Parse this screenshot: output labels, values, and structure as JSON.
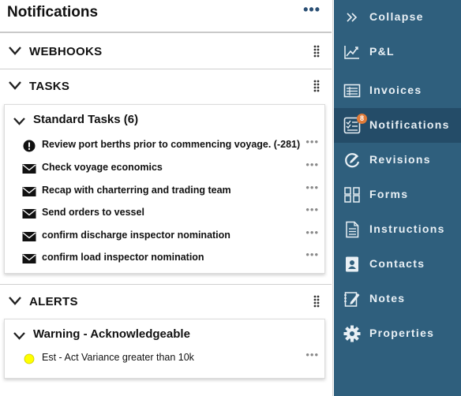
{
  "panel": {
    "title": "Notifications",
    "more_label": "•••"
  },
  "sections": {
    "webhooks": {
      "label": "WEBHOOKS"
    },
    "tasks": {
      "label": "TASKS"
    },
    "alerts": {
      "label": "ALERTS"
    }
  },
  "tasks_group": {
    "title": "Standard Tasks (6)",
    "items": [
      {
        "text": "Review port berths prior to commencing voyage. (-281)",
        "icon": "alert-icon"
      },
      {
        "text": "Check voyage economics",
        "icon": "envelope-icon"
      },
      {
        "text": "Recap with charterring and trading team",
        "icon": "envelope-icon"
      },
      {
        "text": "Send orders to vessel",
        "icon": "envelope-icon"
      },
      {
        "text": "confirm discharge inspector nomination",
        "icon": "envelope-icon"
      },
      {
        "text": "confirm load inspector nomination",
        "icon": "envelope-icon"
      }
    ]
  },
  "alerts_group": {
    "title": "Warning - Acknowledgeable",
    "items": [
      {
        "text": "Est - Act Variance greater than 10k",
        "icon": "yellow-dot-icon"
      }
    ]
  },
  "row_more": "•••",
  "sidebar": {
    "items": [
      {
        "label": "Collapse",
        "icon": "double-chevron-right-icon"
      },
      {
        "label": "P&L",
        "icon": "line-chart-icon"
      },
      {
        "label": "Invoices",
        "icon": "invoice-icon"
      },
      {
        "label": "Notifications",
        "icon": "checklist-icon",
        "badge": "8",
        "active": true
      },
      {
        "label": "Revisions",
        "icon": "revisions-icon"
      },
      {
        "label": "Forms",
        "icon": "forms-icon"
      },
      {
        "label": "Instructions",
        "icon": "document-icon"
      },
      {
        "label": "Contacts",
        "icon": "contact-card-icon"
      },
      {
        "label": "Notes",
        "icon": "notes-pencil-icon"
      },
      {
        "label": "Properties",
        "icon": "gear-icon"
      }
    ]
  },
  "colors": {
    "sidebar_bg": "#2f5f7d",
    "sidebar_active": "#244c68",
    "badge": "#e07b39",
    "alert_dot": "#ffff00"
  }
}
